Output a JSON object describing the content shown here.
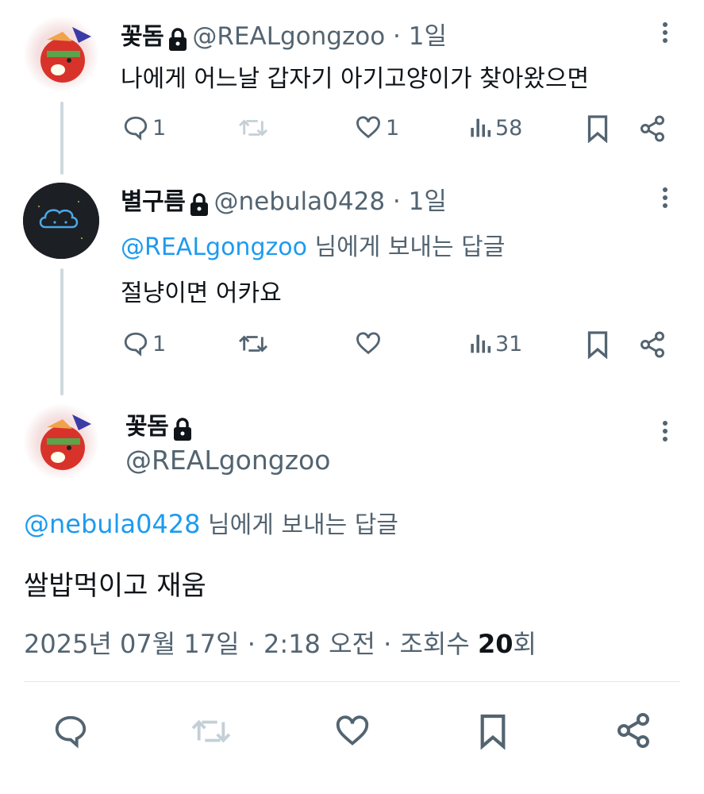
{
  "tweets": [
    {
      "name": "꽃돔",
      "handle": "@REALgongzoo",
      "sep_time": " · 1일",
      "text": "나에게 어느날 갑자기 아기고양이가 찾아왔으면",
      "replies": "1",
      "retweets": "",
      "likes": "1",
      "views": "58"
    },
    {
      "name": "별구름",
      "handle": "@nebula0428",
      "sep_time": " · 1일",
      "reply_mention": "@REALgongzoo",
      "reply_suffix": " 님에게 보내는 답글",
      "text": "절냥이면 어카요",
      "replies": "1",
      "retweets": "",
      "likes": "",
      "views": "31"
    }
  ],
  "main": {
    "name": "꽃돔",
    "handle": "@REALgongzoo",
    "reply_mention": "@nebula0428",
    "reply_suffix": " 님에게 보내는 답글",
    "text": "쌀밥먹이고 재움",
    "date": "2025년 07월 17일 · 2:18 오전 · 조회수 ",
    "view_count": "20",
    "view_suffix": "회"
  },
  "colors": {
    "accent": "#1d9bf0",
    "muted": "#536471",
    "text": "#0f1419",
    "line": "#cfd9de"
  },
  "icons": [
    "reply-icon",
    "retweet-icon",
    "like-icon",
    "views-icon",
    "bookmark-icon",
    "share-icon",
    "lock-icon",
    "more-icon"
  ]
}
